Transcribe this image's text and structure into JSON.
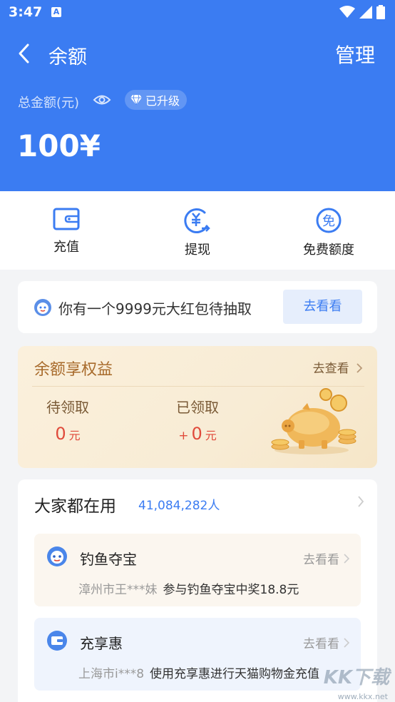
{
  "status_bar": {
    "time": "3:47",
    "notification_letter": "A"
  },
  "header": {
    "title": "余额",
    "manage_label": "管理"
  },
  "balance": {
    "total_label": "总金额(元)",
    "upgrade_badge": "已升级",
    "amount": "100¥"
  },
  "actions": [
    {
      "label": "充值",
      "icon": "wallet-icon"
    },
    {
      "label": "提现",
      "icon": "yuan-withdraw-icon"
    },
    {
      "label": "免费额度",
      "icon": "free-quota-icon"
    }
  ],
  "red_packet": {
    "text": "你有一个9999元大红包待抽取",
    "button": "去看看"
  },
  "benefits": {
    "title": "余额享权益",
    "link": "去查看",
    "pending_label": "待领取",
    "pending_value": "0",
    "received_label": "已领取",
    "received_prefix": "+",
    "received_value": "0",
    "unit": "元"
  },
  "everyone_uses": {
    "title": "大家都在用",
    "count": "41,084,282人",
    "items": [
      {
        "name": "钓鱼夺宝",
        "link": "去看看",
        "user": "漳州市王***妹",
        "desc": "参与钓鱼夺宝中奖18.8元",
        "icon": "fishing-icon"
      },
      {
        "name": "充享惠",
        "link": "去看看",
        "user": "上海市i***8",
        "desc": "使用充享惠进行天猫购物金充值",
        "icon": "wallet-card-icon"
      }
    ]
  },
  "watermark": {
    "text": "KK下载",
    "url": "www.kkx.net"
  },
  "colors": {
    "primary": "#3b7cf2",
    "gold": "#a86b2c",
    "red": "#e04a3b"
  }
}
